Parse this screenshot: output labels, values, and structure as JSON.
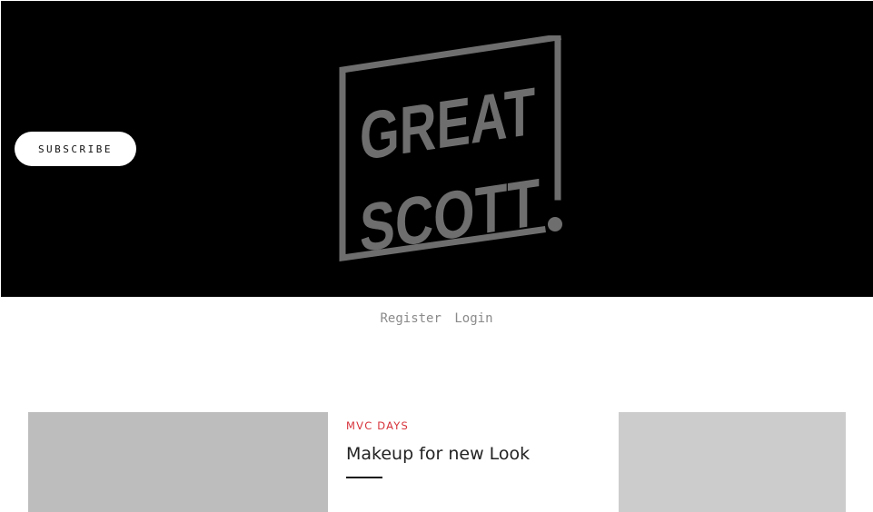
{
  "header": {
    "subscribe_label": "SUBSCRIBE",
    "logo": {
      "line1": "GREAT",
      "line2": "SCOTT",
      "mark": "!"
    }
  },
  "auth": {
    "register_label": "Register",
    "login_label": "Login"
  },
  "featured_post": {
    "category": "MVC DAYS",
    "title": "Makeup for new Look"
  },
  "colors": {
    "hero_background": "#000000",
    "logo_gray": "#6e6e6e",
    "category_red": "#d6323a",
    "link_gray": "#8a8a8a"
  }
}
